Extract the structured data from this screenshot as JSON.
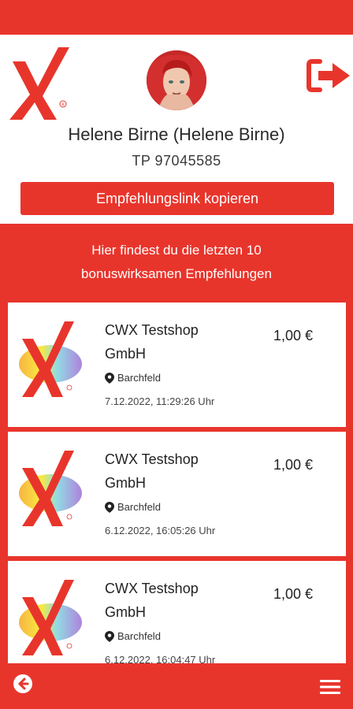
{
  "colors": {
    "brand": "#e8352c",
    "card": "#ffffff",
    "text": "#222222"
  },
  "header": {
    "logout_icon": "logout-icon",
    "logo": "cwx-logo"
  },
  "profile": {
    "name": "Helene Birne (Helene Birne)",
    "tp_number": "TP 97045585",
    "copy_button_label": "Empfehlungslink kopieren"
  },
  "list": {
    "intro_line1": "Hier findest du die letzten 10",
    "intro_line2": "bonuswirksamen Empfehlungen",
    "items": [
      {
        "shop_line1": "CWX Testshop",
        "shop_line2": "GmbH",
        "amount": "1,00 €",
        "location": "Barchfeld",
        "datetime": "7.12.2022, 11:29:26 Uhr"
      },
      {
        "shop_line1": "CWX Testshop",
        "shop_line2": "GmbH",
        "amount": "1,00 €",
        "location": "Barchfeld",
        "datetime": "6.12.2022, 16:05:26 Uhr"
      },
      {
        "shop_line1": "CWX Testshop",
        "shop_line2": "GmbH",
        "amount": "1,00 €",
        "location": "Barchfeld",
        "datetime": "6.12.2022, 16:04:47 Uhr"
      }
    ]
  },
  "footer": {
    "back_icon": "arrow-left-icon",
    "menu_icon": "hamburger-menu-icon"
  }
}
